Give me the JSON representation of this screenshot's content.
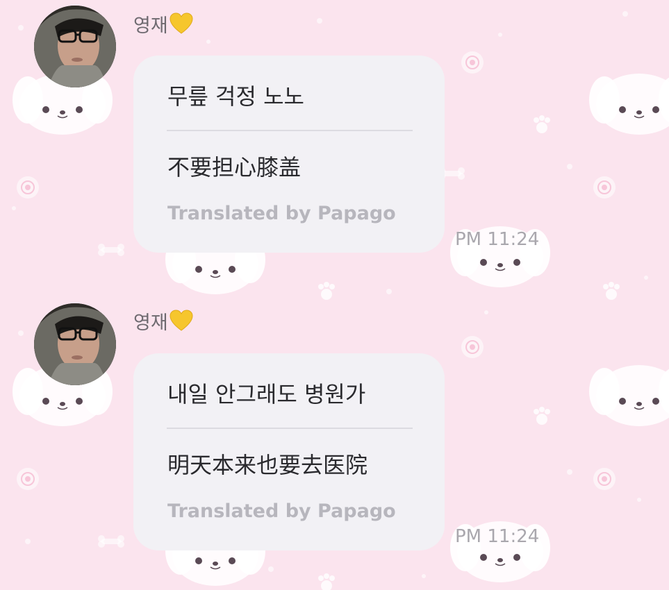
{
  "theme": {
    "background": "#fbe4ee",
    "bubble": "#f2f1f5",
    "text": "#2a2a2e",
    "muted": "#b7b6bd",
    "heart": "#f6c62d"
  },
  "messages": [
    {
      "sender": "영재",
      "sender_emoji": "yellow-heart-icon",
      "original": "무릎 걱정 노노",
      "translation": "不要担心膝盖",
      "translation_credit": "Translated by Papago",
      "time": "PM 11:24"
    },
    {
      "sender": "영재",
      "sender_emoji": "yellow-heart-icon",
      "original": "내일 안그래도 병원가",
      "translation": "明天本来也要去医院",
      "translation_credit": "Translated by Papago",
      "time": "PM 11:24"
    }
  ]
}
